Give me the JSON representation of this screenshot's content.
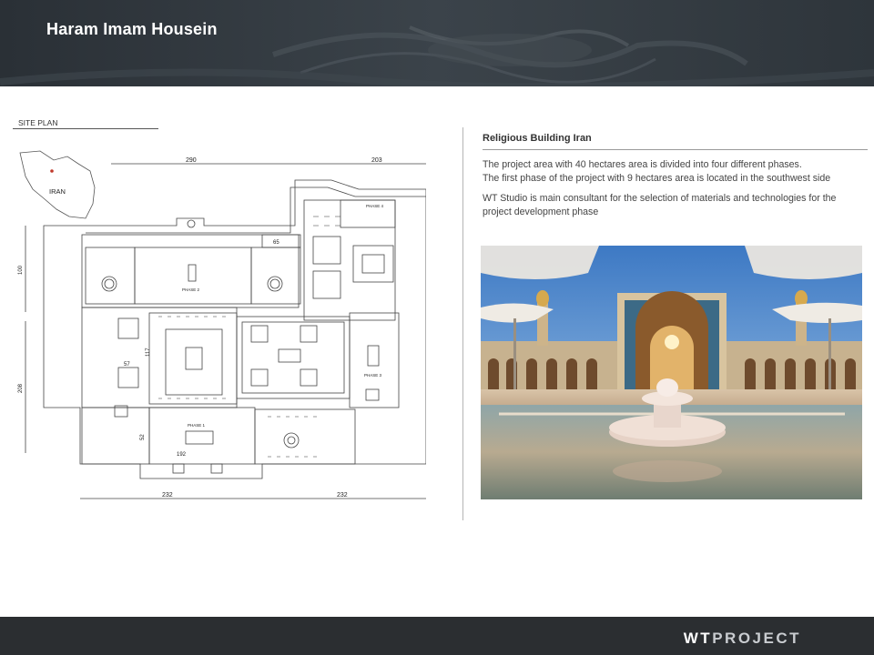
{
  "slide": {
    "title": "Haram Imam Housein"
  },
  "site_plan": {
    "label": "SITE PLAN",
    "map_country": "IRAN",
    "dimensions": [
      "290",
      "203",
      "65",
      "100",
      "57",
      "117",
      "208",
      "192",
      "52",
      "232",
      "232"
    ],
    "phases": [
      "PHASE 1",
      "PHASE 2",
      "PHASE 3",
      "PHASE 4"
    ]
  },
  "info": {
    "heading": "Religious Building Iran",
    "line1": "The project area with 40 hectares area is divided into four different phases.",
    "line2": "The first phase of the project with 9 hectares area is located in the southwest  side",
    "para2": "WT Studio is main consultant for the selection of materials and technologies for the project development phase"
  },
  "footer": {
    "logo_wt": "WT",
    "logo_project": "PROJECT"
  },
  "colors": {
    "header_bg": "#353b41",
    "footer_bg": "#2b2e31",
    "title_text": "#ffffff"
  }
}
